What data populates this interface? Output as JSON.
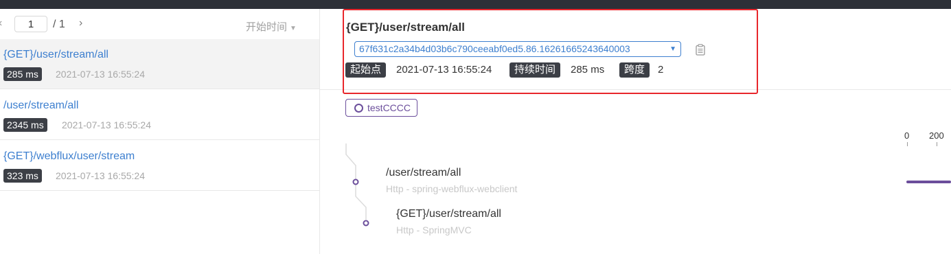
{
  "pager": {
    "prev_icon": "‹",
    "current_page": "1",
    "total": "/ 1",
    "next_icon": "›",
    "sort_label": "开始时间",
    "sort_caret": "▼"
  },
  "traces": [
    {
      "name": "{GET}/user/stream/all",
      "duration": "285 ms",
      "time": "2021-07-13 16:55:24",
      "active": true
    },
    {
      "name": "/user/stream/all",
      "duration": "2345 ms",
      "time": "2021-07-13 16:55:24",
      "active": false
    },
    {
      "name": "{GET}/webflux/user/stream",
      "duration": "323 ms",
      "time": "2021-07-13 16:55:24",
      "active": false
    }
  ],
  "detail": {
    "title": "{GET}/user/stream/all",
    "trace_id": "67f631c2a34b4d03b6c790ceeabf0ed5.86.16261665243640003",
    "select_caret": "▼",
    "start_label": "起始点",
    "start_value": "2021-07-13 16:55:24",
    "duration_label": "持续时间",
    "duration_value": "285 ms",
    "span_label": "跨度",
    "span_value": "2",
    "service_chip": "testCCCC"
  },
  "spans": [
    {
      "name": "/user/stream/all",
      "sub": "Http - spring-webflux-webclient"
    },
    {
      "name": "{GET}/user/stream/all",
      "sub": "Http - SpringMVC"
    }
  ],
  "timeline": {
    "ticks": [
      "0",
      "200"
    ],
    "bar_color": "#6b4e9b"
  },
  "colors": {
    "accent": "#3d7fcf",
    "service": "#6b4e9b",
    "highlight": "#e8262b",
    "badge": "#3c3f46"
  }
}
